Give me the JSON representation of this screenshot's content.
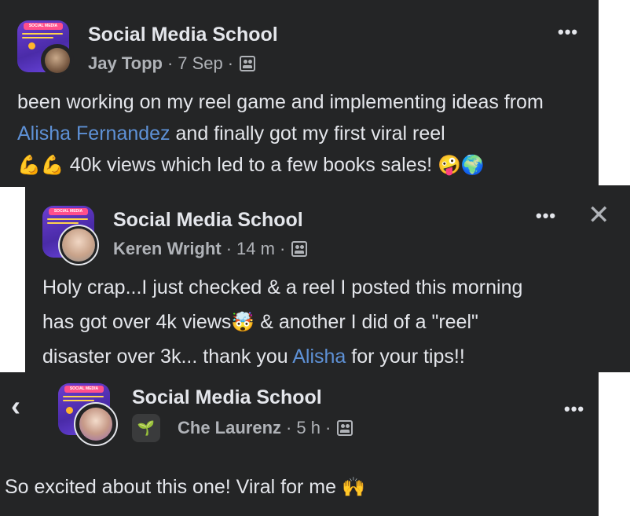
{
  "posts": [
    {
      "group": "Social Media School",
      "author": "Jay Topp",
      "time": "7 Sep",
      "thumb_banner": "SOCIAL MEDIA",
      "body_parts": [
        "been working on my reel game and implementing ideas from ",
        "Alisha Fernandez",
        " and finally got my first viral reel"
      ],
      "body_line3": " 40k views which led to a few books sales! ",
      "emoji_start": "💪💪",
      "emoji_end": "🤪🌍"
    },
    {
      "group": "Social Media School",
      "author": "Keren Wright",
      "time": "14 m",
      "thumb_banner": "SOCIAL MEDIA",
      "line1": "Holy crap...I just checked & a reel I posted this morning",
      "line2a": "has got over 4k views",
      "emoji_mid": "🤯",
      "line2b": " & another I did of a \"reel\"",
      "line3a": "disaster over 3k... thank you ",
      "mention": "Alisha",
      "line3b": " for your tips!!"
    },
    {
      "group": "Social Media School",
      "author": "Che Laurenz",
      "time": "5 h",
      "thumb_banner": "SOCIAL MEDIA",
      "body": "So excited about this one! Viral for me ",
      "emoji_end": "🙌"
    }
  ],
  "icons": {
    "more": "•••",
    "close": "✕",
    "back": "‹",
    "sprout": "🌱"
  },
  "colors": {
    "card_bg": "#242526",
    "mention": "#5e91d6",
    "group_thumb": "#5a34c2"
  }
}
